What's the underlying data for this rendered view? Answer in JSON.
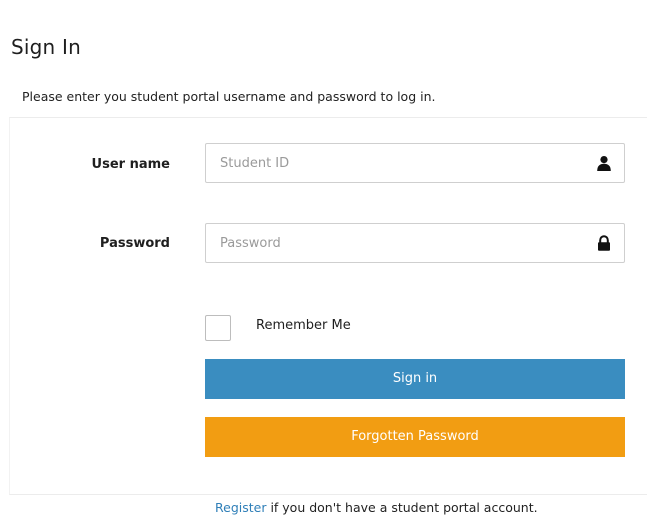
{
  "page": {
    "title": "Sign In",
    "intro": "Please enter you student portal username and password to log in."
  },
  "form": {
    "username_label": "User name",
    "username_placeholder": "Student ID",
    "username_value": "",
    "password_label": "Password",
    "password_placeholder": "Password",
    "password_value": "",
    "remember_label": "Remember Me",
    "remember_checked": false,
    "signin_label": "Sign in",
    "forgot_label": "Forgotten Password"
  },
  "footer": {
    "register_link": "Register",
    "register_text": " if you don't have a student portal account."
  },
  "icons": {
    "username_icon": "user-icon",
    "password_icon": "lock-icon"
  },
  "colors": {
    "signin_button": "#3a8dc0",
    "forgot_button": "#f29d12",
    "link": "#2f7fb8"
  }
}
